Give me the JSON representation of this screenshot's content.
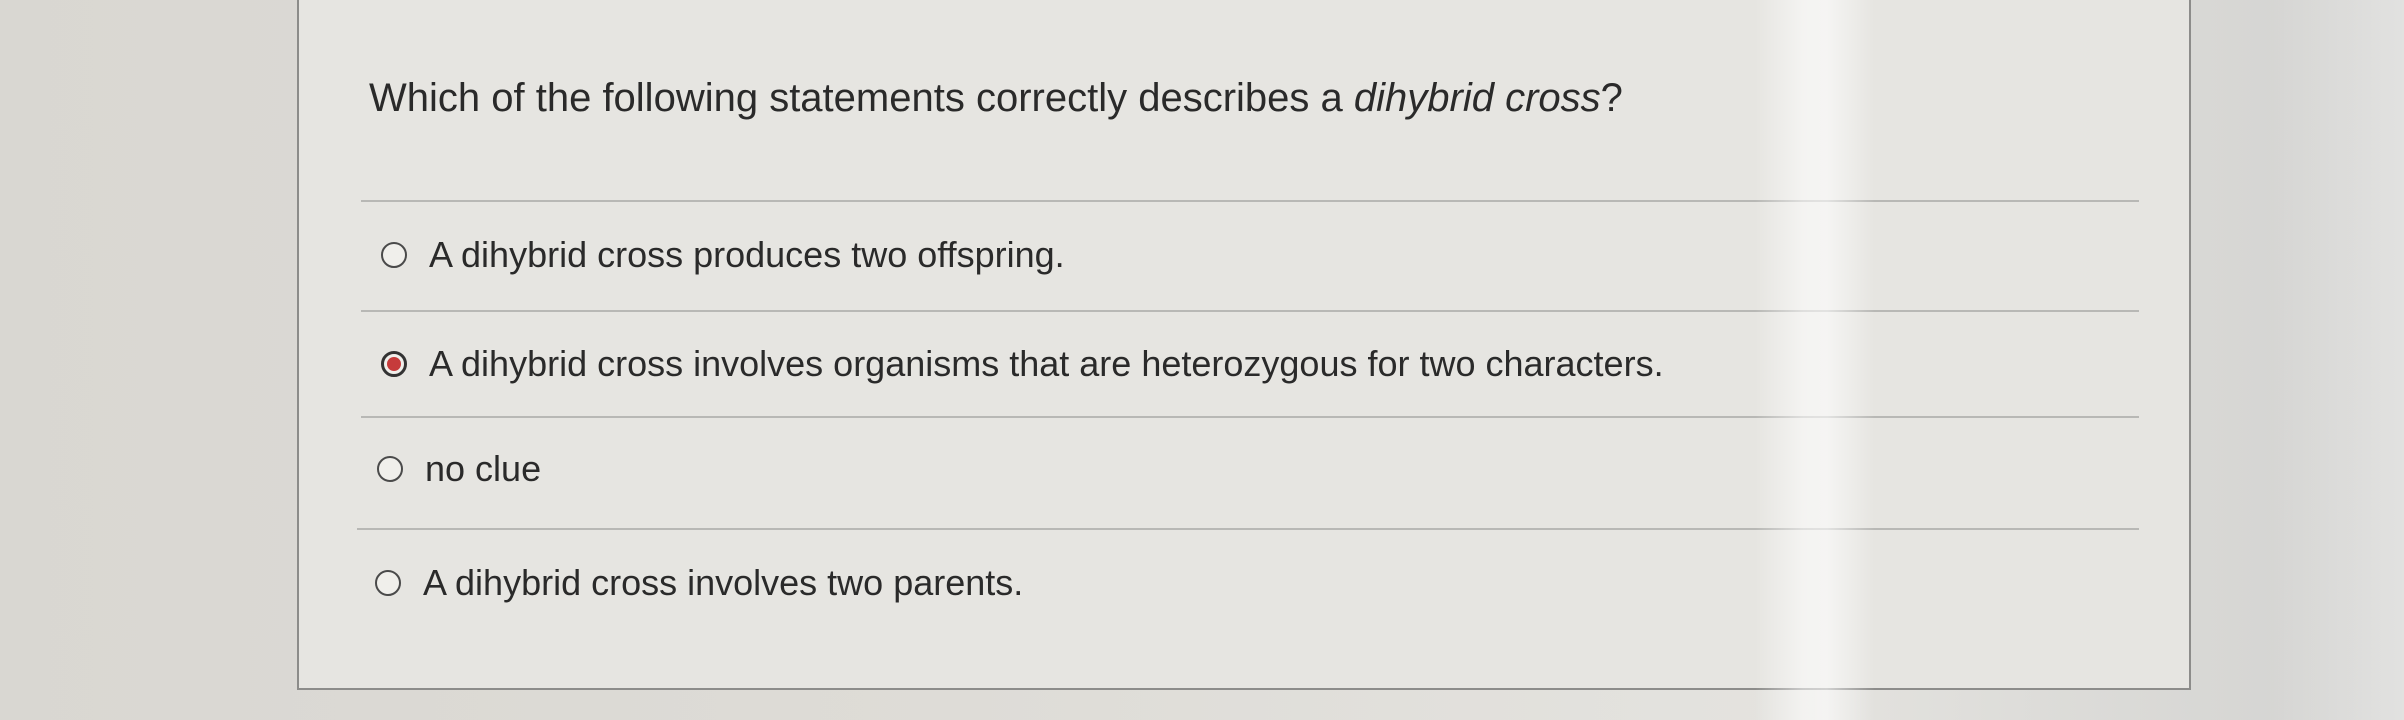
{
  "question": {
    "prompt_prefix": "Which of the following statements correctly describes a ",
    "prompt_emphasis": "dihybrid cross",
    "prompt_suffix": "?"
  },
  "options": [
    {
      "label": "A dihybrid cross produces two offspring.",
      "selected": false
    },
    {
      "label": "A dihybrid cross involves organisms that are heterozygous for two characters.",
      "selected": true
    },
    {
      "label": "no clue",
      "selected": false
    },
    {
      "label": "A dihybrid cross involves two parents.",
      "selected": false
    }
  ],
  "colors": {
    "selected_radio": "#c63b3b",
    "card_background": "#e6e5e1",
    "text": "#2a2a2a"
  }
}
